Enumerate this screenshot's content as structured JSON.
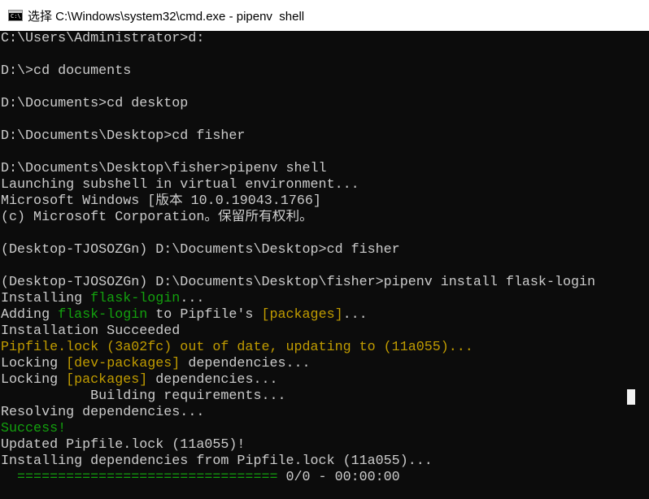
{
  "window": {
    "title": "选择 C:\\Windows\\system32\\cmd.exe - pipenv  shell",
    "icon": "cmd-icon"
  },
  "colors": {
    "background": "#0c0c0c",
    "text": "#cccccc",
    "green": "#13a10e",
    "yellow": "#c19c00"
  },
  "console": {
    "lines": [
      [
        {
          "t": "C:\\Users\\Administrator>d:",
          "c": "gray"
        }
      ],
      [],
      [
        {
          "t": "D:\\>cd documents",
          "c": "gray"
        }
      ],
      [],
      [
        {
          "t": "D:\\Documents>cd desktop",
          "c": "gray"
        }
      ],
      [],
      [
        {
          "t": "D:\\Documents\\Desktop>cd fisher",
          "c": "gray"
        }
      ],
      [],
      [
        {
          "t": "D:\\Documents\\Desktop\\fisher>pipenv shell",
          "c": "gray"
        }
      ],
      [
        {
          "t": "Launching subshell in virtual environment...",
          "c": "gray"
        }
      ],
      [
        {
          "t": "Microsoft Windows [版本 10.0.19043.1766]",
          "c": "gray"
        }
      ],
      [
        {
          "t": "(c) Microsoft Corporation。保留所有权利。",
          "c": "gray"
        }
      ],
      [],
      [
        {
          "t": "(Desktop-TJOSOZGn) D:\\Documents\\Desktop>cd fisher",
          "c": "gray"
        }
      ],
      [],
      [
        {
          "t": "(Desktop-TJOSOZGn) D:\\Documents\\Desktop\\fisher>pipenv install flask-login",
          "c": "gray"
        }
      ],
      [
        {
          "t": "Installing ",
          "c": "gray"
        },
        {
          "t": "flask-login",
          "c": "green"
        },
        {
          "t": "...",
          "c": "gray"
        }
      ],
      [
        {
          "t": "Adding ",
          "c": "gray"
        },
        {
          "t": "flask-login",
          "c": "green"
        },
        {
          "t": " to Pipfile's ",
          "c": "gray"
        },
        {
          "t": "[packages]",
          "c": "yellow"
        },
        {
          "t": "...",
          "c": "gray"
        }
      ],
      [
        {
          "t": "Installation Succeeded",
          "c": "gray"
        }
      ],
      [
        {
          "t": "Pipfile.lock (3a02fc) out of date, updating to (11a055)...",
          "c": "yellow"
        }
      ],
      [
        {
          "t": "Locking ",
          "c": "gray"
        },
        {
          "t": "[dev-packages]",
          "c": "yellow"
        },
        {
          "t": " dependencies...",
          "c": "gray"
        }
      ],
      [
        {
          "t": "Locking ",
          "c": "gray"
        },
        {
          "t": "[packages]",
          "c": "yellow"
        },
        {
          "t": " dependencies...",
          "c": "gray"
        }
      ],
      [
        {
          "t": "           Building requirements...",
          "c": "gray"
        }
      ],
      [
        {
          "t": "Resolving dependencies...",
          "c": "gray"
        }
      ],
      [
        {
          "t": "Success!",
          "c": "green"
        }
      ],
      [
        {
          "t": "Updated Pipfile.lock (11a055)!",
          "c": "gray"
        }
      ],
      [
        {
          "t": "Installing dependencies from Pipfile.lock (11a055)...",
          "c": "gray"
        }
      ],
      [
        {
          "t": "  ================================",
          "c": "green"
        },
        {
          "t": " 0/0 - 00:00:00",
          "c": "gray"
        }
      ]
    ]
  }
}
